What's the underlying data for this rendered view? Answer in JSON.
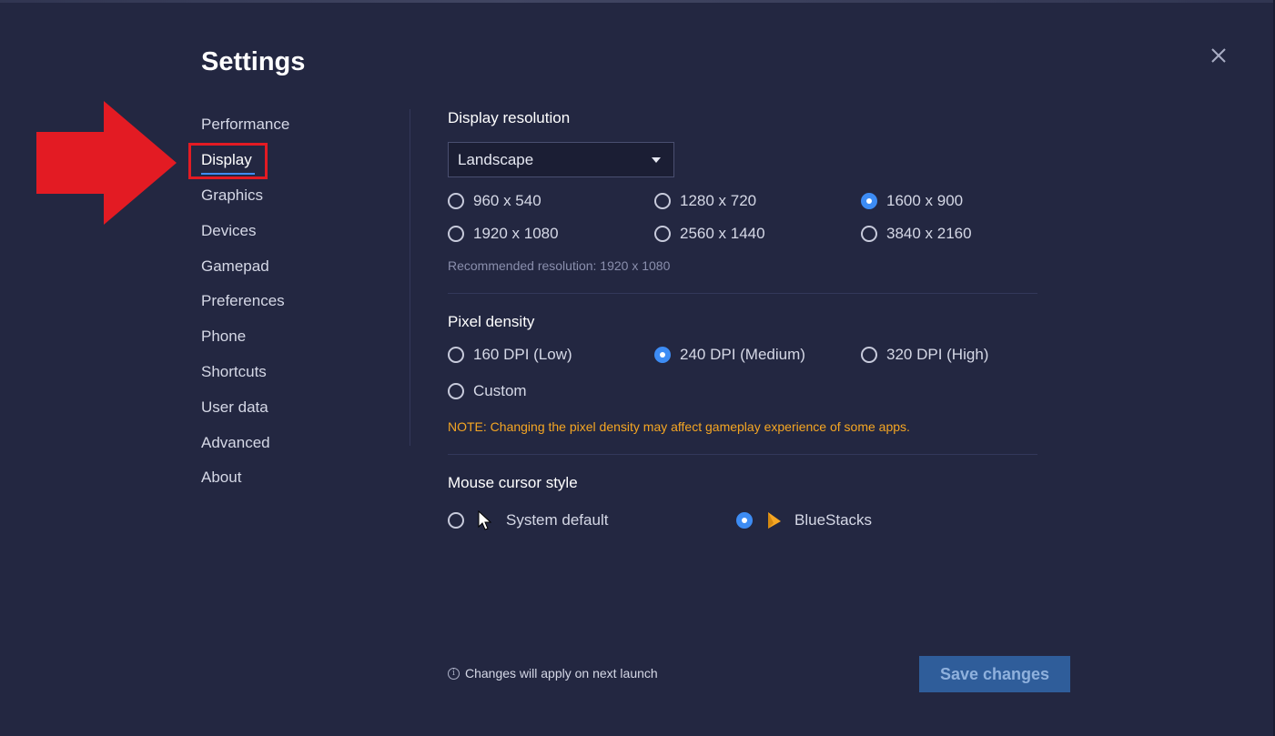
{
  "window": {
    "title": "Settings"
  },
  "sidebar": {
    "items": [
      {
        "label": "Performance"
      },
      {
        "label": "Display"
      },
      {
        "label": "Graphics"
      },
      {
        "label": "Devices"
      },
      {
        "label": "Gamepad"
      },
      {
        "label": "Preferences"
      },
      {
        "label": "Phone"
      },
      {
        "label": "Shortcuts"
      },
      {
        "label": "User data"
      },
      {
        "label": "Advanced"
      },
      {
        "label": "About"
      }
    ],
    "active": "Display"
  },
  "display_resolution": {
    "title": "Display resolution",
    "orientation": "Landscape",
    "options": [
      "960 x 540",
      "1280 x 720",
      "1600 x 900",
      "1920 x 1080",
      "2560 x 1440",
      "3840 x 2160"
    ],
    "selected": "1600 x 900",
    "recommended": "Recommended resolution: 1920 x 1080"
  },
  "pixel_density": {
    "title": "Pixel density",
    "options": [
      "160 DPI (Low)",
      "240 DPI (Medium)",
      "320 DPI (High)",
      "Custom"
    ],
    "selected": "240 DPI (Medium)",
    "note": "NOTE: Changing the pixel density may affect gameplay experience of some apps."
  },
  "mouse_cursor": {
    "title": "Mouse cursor style",
    "options": [
      "System default",
      "BlueStacks"
    ],
    "selected": "BlueStacks"
  },
  "footer": {
    "info": "Changes will apply on next launch",
    "save_label": "Save changes"
  },
  "colors": {
    "background": "#232741",
    "accent": "#3d8cf4",
    "note": "#f5a623",
    "annotation": "#e31b23",
    "save_button": "#2f5d9a"
  }
}
